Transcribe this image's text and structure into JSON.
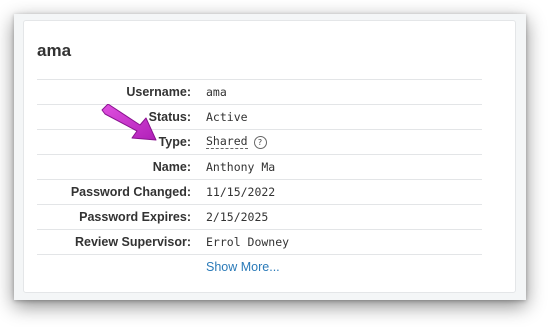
{
  "card": {
    "title": "ama",
    "rows": [
      {
        "label": "Username:",
        "value": "ama"
      },
      {
        "label": "Status:",
        "value": "Active"
      },
      {
        "label": "Type:",
        "value": "Shared"
      },
      {
        "label": "Name:",
        "value": "Anthony Ma"
      },
      {
        "label": "Password Changed:",
        "value": "11/15/2022"
      },
      {
        "label": "Password Expires:",
        "value": "2/15/2025"
      },
      {
        "label": "Review Supervisor:",
        "value": "Errol Downey"
      }
    ],
    "show_more": "Show More...",
    "help_glyph": "?"
  },
  "colors": {
    "link": "#2a7ab8",
    "arrow": "#cc33cc"
  }
}
